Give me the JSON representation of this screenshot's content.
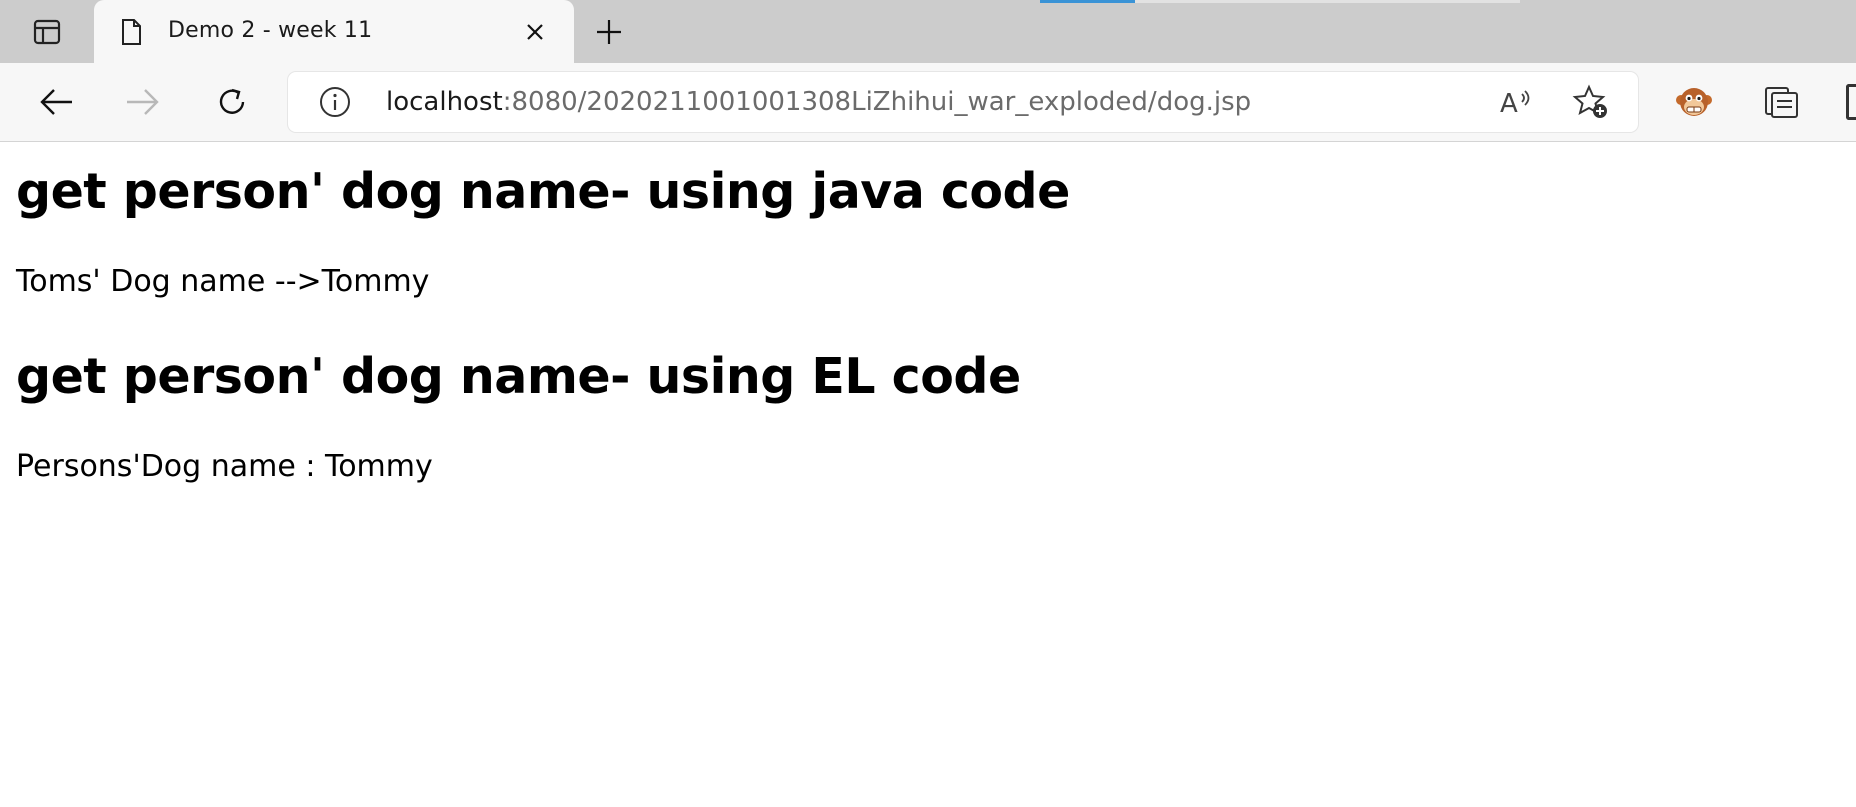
{
  "browser": {
    "tab": {
      "title": "Demo 2 - week 11",
      "favicon": "page-icon",
      "close_icon": "close-icon"
    },
    "new_tab_icon": "plus-icon",
    "tab_actions_icon": "tab-actions-icon",
    "nav": {
      "back_icon": "back-arrow-icon",
      "forward_icon": "forward-arrow-icon",
      "reload_icon": "reload-icon"
    },
    "address": {
      "info_icon": "info-icon",
      "host": "localhost",
      "path": ":8080/202021100100​1308LiZhihui_war_exploded/dog.jsp",
      "read_aloud_icon": "read-aloud-icon",
      "favorite_icon": "add-favorite-icon"
    },
    "extension_icon": "monkey-extension-icon",
    "collections_icon": "collections-icon"
  },
  "page": {
    "heading_java": "get person' dog name- using java code",
    "text_java": "Toms' Dog name -->Tommy",
    "heading_el": "get person' dog name- using EL code",
    "text_el": "Persons'Dog name : Tommy"
  },
  "colors": {
    "tabstrip_bg": "#cccccc",
    "toolbar_bg": "#f7f7f7",
    "loading_accent": "#3a93d6",
    "url_path": "#6b6b6b"
  }
}
